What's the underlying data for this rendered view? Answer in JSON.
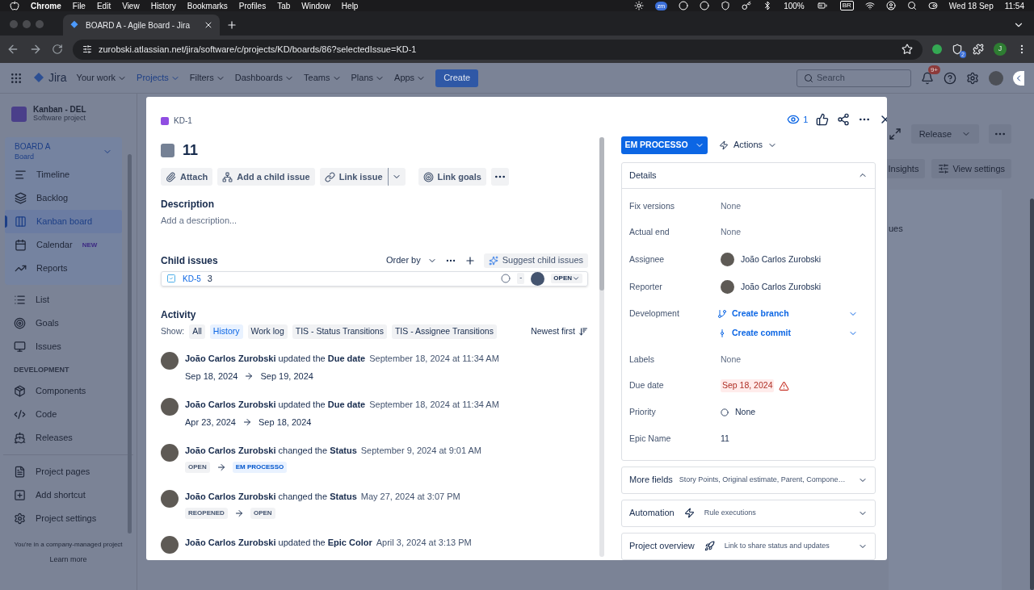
{
  "menubar": {
    "app": "Chrome",
    "menus": [
      "File",
      "Edit",
      "View",
      "History",
      "Bookmarks",
      "Profiles",
      "Tab",
      "Window",
      "Help"
    ],
    "zoom_badge": "zm",
    "battery": "100%",
    "keyboard": "BR",
    "date": "Wed 18 Sep",
    "time": "11:54"
  },
  "browser": {
    "tab_title": "BOARD A - Agile Board - Jira",
    "url": "zurobski.atlassian.net/jira/software/c/projects/KD/boards/86?selectedIssue=KD-1",
    "extension_badge": "2",
    "profile": "J"
  },
  "jira_nav": {
    "product": "Jira",
    "items": [
      {
        "label": "Your work",
        "selected": false
      },
      {
        "label": "Projects",
        "selected": true
      },
      {
        "label": "Filters",
        "selected": false
      },
      {
        "label": "Dashboards",
        "selected": false
      },
      {
        "label": "Teams",
        "selected": false
      },
      {
        "label": "Plans",
        "selected": false
      },
      {
        "label": "Apps",
        "selected": false
      }
    ],
    "create": "Create",
    "search_placeholder": "Search",
    "notifications": "9+"
  },
  "sidebar": {
    "project": "Kanban - DEL",
    "project_type": "Software project",
    "board": "BOARD A",
    "board_type": "Board",
    "board_items": [
      {
        "label": "Timeline",
        "selected": false
      },
      {
        "label": "Backlog",
        "selected": false
      },
      {
        "label": "Kanban board",
        "selected": true
      },
      {
        "label": "Calendar",
        "selected": false,
        "badge": "NEW"
      },
      {
        "label": "Reports",
        "selected": false
      }
    ],
    "items": [
      "List",
      "Goals",
      "Issues"
    ],
    "section": "DEVELOPMENT",
    "dev_items": [
      "Components",
      "Code",
      "Releases"
    ],
    "footer_items": [
      "Project pages",
      "Add shortcut",
      "Project settings"
    ],
    "note": "You're in a company-managed project",
    "link": "Learn more"
  },
  "board": {
    "release": "Release",
    "insights": "Insights",
    "view_settings": "View settings",
    "column_text": "ues"
  },
  "issue": {
    "key": "KD-1",
    "title": "11",
    "toolbar": [
      "Attach",
      "Add a child issue",
      "Link issue",
      "Link goals"
    ],
    "description_heading": "Description",
    "description_placeholder": "Add a description...",
    "child_heading": "Child issues",
    "order_by": "Order by",
    "suggest": "Suggest child issues",
    "children": [
      {
        "key": "KD-5",
        "summary": "3",
        "priority": "-",
        "status": "OPEN"
      }
    ],
    "activity_heading": "Activity",
    "show_label": "Show:",
    "filters": [
      {
        "label": "All",
        "selected": false
      },
      {
        "label": "History",
        "selected": true
      },
      {
        "label": "Work log",
        "selected": false
      },
      {
        "label": "TIS - Status Transitions",
        "selected": false
      },
      {
        "label": "TIS - Assignee Transitions",
        "selected": false
      }
    ],
    "sort": "Newest first",
    "activity": [
      {
        "text": "**João Carlos Zurobski** updated the **Due date**",
        "time": "September 18, 2024 at 11:34 AM",
        "from": {
          "label": "Sep 18, 2024",
          "kind": "date"
        },
        "to": {
          "label": "Sep 19, 2024",
          "kind": "date"
        }
      },
      {
        "text": "**João Carlos Zurobski** updated the **Due date**",
        "time": "September 18, 2024 at 11:34 AM",
        "from": {
          "label": "Apr 23, 2024",
          "kind": "date"
        },
        "to": {
          "label": "Sep 18, 2024",
          "kind": "date"
        }
      },
      {
        "text": "**João Carlos Zurobski** changed the **Status**",
        "time": "September 9, 2024 at 9:01 AM",
        "from": {
          "label": "OPEN",
          "kind": "todo"
        },
        "to": {
          "label": "EM PROCESSO",
          "kind": "inprogress"
        }
      },
      {
        "text": "**João Carlos Zurobski** changed the **Status**",
        "time": "May 27, 2024 at 3:07 PM",
        "from": {
          "label": "REOPENED",
          "kind": "todo"
        },
        "to": {
          "label": "OPEN",
          "kind": "todo"
        }
      },
      {
        "text": "**João Carlos Zurobski** updated the **Epic Color**",
        "time": "April 3, 2024 at 3:13 PM"
      }
    ],
    "watchers": "1",
    "status": "EM PROCESSO",
    "actions": "Actions",
    "sections": [
      {
        "title": "Details",
        "expanded": true,
        "fields": [
          {
            "label": "Fix versions",
            "kind": "empty",
            "value": "None"
          },
          {
            "label": "Actual end",
            "kind": "empty",
            "value": "None"
          },
          {
            "label": "Assignee",
            "kind": "user",
            "value": "João Carlos Zurobski"
          },
          {
            "label": "Reporter",
            "kind": "user",
            "value": "João Carlos Zurobski"
          },
          {
            "label": "Development",
            "kind": "links",
            "links": [
              "Create branch",
              "Create commit"
            ]
          },
          {
            "label": "Labels",
            "kind": "empty",
            "value": "None"
          },
          {
            "label": "Due date",
            "kind": "overdue",
            "value": "Sep 18, 2024"
          },
          {
            "label": "Priority",
            "kind": "priority",
            "value": "None"
          },
          {
            "label": "Epic Name",
            "kind": "text",
            "value": "11"
          }
        ]
      },
      {
        "title": "More fields",
        "kind": "fields",
        "expanded": false,
        "summary": "Story Points, Original estimate, Parent, Compone…"
      },
      {
        "title": "Automation",
        "kind": "automation",
        "expanded": false,
        "summary": "Rule executions"
      },
      {
        "title": "Project overview",
        "kind": "overview",
        "expanded": false,
        "summary": "Link to share status and updates"
      }
    ]
  }
}
